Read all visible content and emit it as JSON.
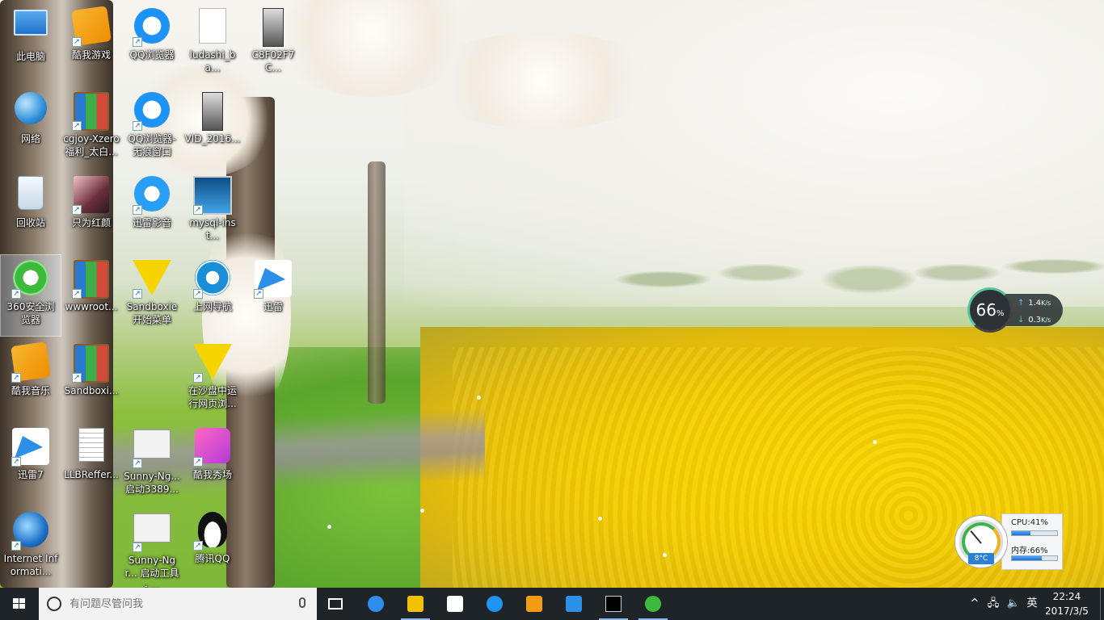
{
  "desktop": {
    "icons": [
      {
        "label": "此电脑",
        "art": "pc"
      },
      {
        "label": "网络",
        "art": "network"
      },
      {
        "label": "回收站",
        "art": "recycle-bin"
      },
      {
        "label": "360安全浏览器",
        "art": "360-browser"
      },
      {
        "label": "酷我音乐",
        "art": "kuwo-music"
      },
      {
        "label": "迅雷7",
        "art": "thunder"
      },
      {
        "label": "Internet Informati...",
        "art": "iis"
      },
      {
        "label": "酷我游戏",
        "art": "kuwo-game"
      },
      {
        "label": "cgjoy-Xzero福利_太白...",
        "art": "winrar"
      },
      {
        "label": "只为红颜",
        "art": "game"
      },
      {
        "label": "wwwroot...",
        "art": "winrar"
      },
      {
        "label": "Sandboxi...",
        "art": "winrar"
      },
      {
        "label": "LLBReffer...",
        "art": "text-file"
      },
      {
        "label": "QQ浏览器",
        "art": "qq-browser"
      },
      {
        "label": "QQ浏览器-无痕窗口",
        "art": "qq-browser-private"
      },
      {
        "label": "迅雷影音",
        "art": "thunder-player"
      },
      {
        "label": "Sandboxie 开始菜单",
        "art": "sandboxie"
      },
      {
        "label": "Sunny-Ng... 启动3389...",
        "art": "cmd-file"
      },
      {
        "label": "Sunny-Ngr... 启动工具 - ...",
        "art": "cmd-file"
      },
      {
        "label": "ludashi_ba...",
        "art": "file"
      },
      {
        "label": "VID_2016...",
        "art": "video"
      },
      {
        "label": "mysql-inst...",
        "art": "installer"
      },
      {
        "label": "上网导航",
        "art": "ie"
      },
      {
        "label": "在沙盘中运行网页浏...",
        "art": "sandboxie"
      },
      {
        "label": "酷我秀场",
        "art": "kuwo-show"
      },
      {
        "label": "腾讯QQ",
        "art": "qq"
      },
      {
        "label": "C8F02F7C...",
        "art": "video"
      },
      {
        "label": "迅雷",
        "art": "thunder"
      }
    ]
  },
  "net_widget": {
    "percent": "66",
    "percent_unit": "%",
    "up_value": "1.4",
    "up_unit": "K/s",
    "down_value": "0.3",
    "down_unit": "K/s"
  },
  "sys_widget": {
    "temp": "8°C",
    "cpu_label": "CPU:41%",
    "cpu_percent": 41,
    "mem_label": "内存:66%",
    "mem_percent": 66
  },
  "taskbar": {
    "search_placeholder": "有问题尽管问我",
    "pinned": [
      {
        "name": "task-view",
        "icon": "task-view-icon"
      },
      {
        "name": "edge",
        "icon": "edge-icon"
      },
      {
        "name": "file-explorer",
        "icon": "folder-icon"
      },
      {
        "name": "store",
        "icon": "store-icon"
      },
      {
        "name": "qq-browser",
        "icon": "qq-browser-icon"
      },
      {
        "name": "kuwo-music",
        "icon": "kuwo-icon"
      },
      {
        "name": "thunder",
        "icon": "thunder-icon"
      },
      {
        "name": "cmd",
        "icon": "cmd-icon"
      },
      {
        "name": "360-browser",
        "icon": "360-browser-icon"
      }
    ],
    "ime": "英",
    "time": "22:24",
    "date": "2017/3/5"
  },
  "colors": {
    "taskbar_bg": "#181c22",
    "accent": "#8bb8e8"
  }
}
